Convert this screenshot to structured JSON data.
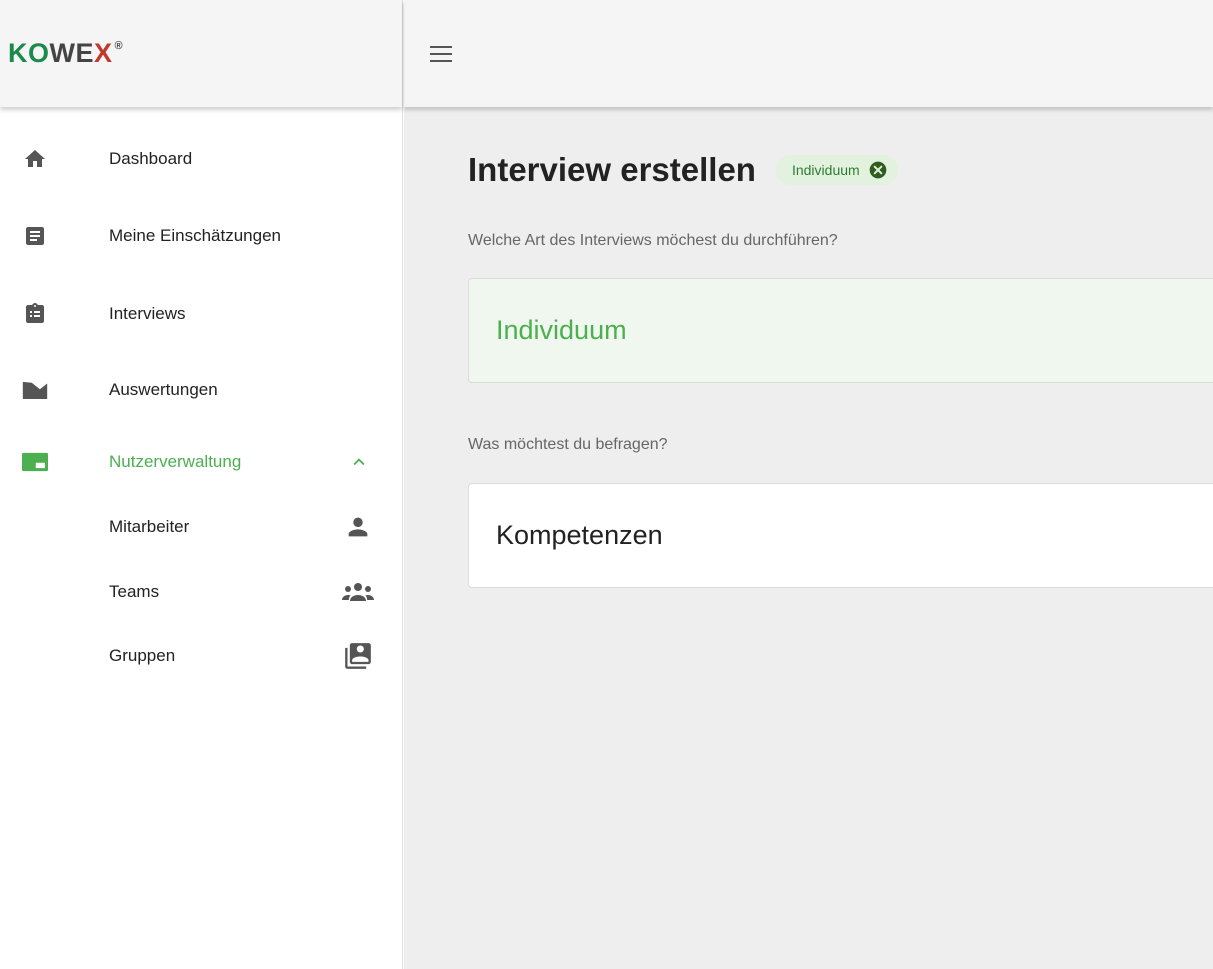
{
  "logo": {
    "part1": "KO",
    "part2": "WE",
    "part3": "X",
    "reg": "®"
  },
  "nav": {
    "dashboard": "Dashboard",
    "assessments": "Meine Einschätzungen",
    "interviews": "Interviews",
    "evaluations": "Auswertungen",
    "user_management": "Nutzerverwaltung",
    "employees": "Mitarbeiter",
    "teams": "Teams",
    "groups": "Gruppen"
  },
  "main": {
    "title": "Interview erstellen",
    "chip_label": "Individuum",
    "question1": "Welche Art des Interviews möchest du durchführen?",
    "option1": "Individuum",
    "question2": "Was möchtest du befragen?",
    "option2": "Kompetenzen"
  },
  "colors": {
    "accent": "#4caf50",
    "logo_green": "#1b8a4c",
    "logo_red": "#c0392b",
    "chip_bg": "#e3f1df"
  },
  "icons": {
    "dashboard": "home-icon",
    "assessments": "document-icon",
    "interviews": "clipboard-icon",
    "evaluations": "area-chart-icon",
    "user_management": "web-asset-icon",
    "employees": "person-icon",
    "teams": "groups-icon",
    "groups": "contact-list-icon"
  }
}
